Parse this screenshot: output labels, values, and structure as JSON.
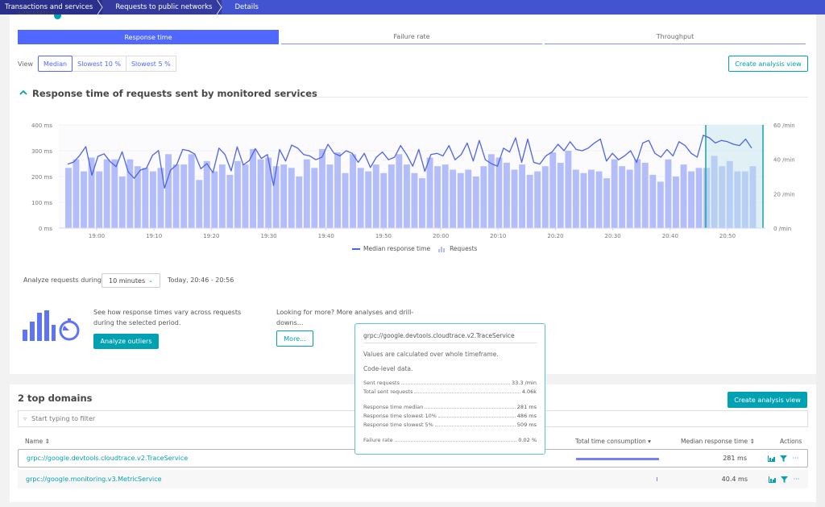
{
  "breadcrumb": [
    {
      "label": "Transactions and services"
    },
    {
      "label": "Requests to public networks"
    },
    {
      "label": "Details"
    }
  ],
  "details": {
    "title": "Details",
    "info_icon": "info-icon"
  },
  "tabs": [
    {
      "label": "Response time",
      "active": true
    },
    {
      "label": "Failure rate",
      "active": false
    },
    {
      "label": "Throughput",
      "active": false
    }
  ],
  "view": {
    "label": "View",
    "options": [
      "Median",
      "Slowest 10 %",
      "Slowest 5 %"
    ],
    "selected": "Median"
  },
  "create_analysis_view_label": "Create analysis view",
  "section": {
    "title": "Response time of requests sent by monitored services",
    "collapse_icon": "chevron-up-icon"
  },
  "chart_data": {
    "type": "bar",
    "title": "Response time of requests sent by monitored services",
    "x_ticks": [
      "19:00",
      "19:10",
      "19:20",
      "19:30",
      "19:40",
      "19:50",
      "20:00",
      "20:10",
      "20:20",
      "20:30",
      "20:40",
      "20:50"
    ],
    "y_left_ticks": [
      "0 ms",
      "100 ms",
      "200 ms",
      "300 ms",
      "400 ms"
    ],
    "y_right_ticks": [
      "0 /min",
      "20 /min",
      "40 /min",
      "60 /min"
    ],
    "y_left_range": [
      0,
      400
    ],
    "y_right_range": [
      0,
      60
    ],
    "selection": {
      "from": "20:46",
      "to": "20:56"
    },
    "series": [
      {
        "name": "Median response time",
        "type": "line",
        "axis": "left",
        "unit": "ms",
        "values": [
          248,
          256,
          282,
          316,
          205,
          278,
          288,
          258,
          238,
          296,
          218,
          193,
          225,
          232,
          282,
          301,
          155,
          225,
          245,
          305,
          300,
          287,
          230,
          250,
          215,
          310,
          285,
          222,
          315,
          245,
          262,
          308,
          270,
          285,
          165,
          305,
          260,
          322,
          310,
          285,
          280,
          265,
          275,
          325,
          290,
          280,
          300,
          290,
          255,
          290,
          235,
          275,
          295,
          265,
          275,
          320,
          285,
          240,
          305,
          220,
          285,
          290,
          280,
          320,
          265,
          285,
          330,
          260,
          340,
          265,
          250,
          240,
          310,
          295,
          350,
          255,
          345,
          255,
          248,
          280,
          295,
          325,
          300,
          335,
          305,
          300,
          310,
          330,
          345,
          260,
          290,
          265,
          280,
          300,
          255,
          330,
          340,
          290,
          275,
          305,
          280,
          335,
          320,
          290,
          275,
          360,
          350,
          330,
          340,
          335,
          325,
          320,
          345,
          310
        ]
      },
      {
        "name": "Requests",
        "type": "bar",
        "axis": "right",
        "unit": "/min",
        "values": [
          35,
          40,
          33,
          41,
          33,
          40,
          40,
          30,
          40,
          36,
          35,
          33,
          35,
          43,
          37,
          37,
          43,
          28,
          39,
          33,
          37,
          31,
          39,
          37,
          46,
          40,
          41,
          36,
          37,
          35,
          30,
          40,
          35,
          46,
          37,
          44,
          32,
          43,
          35,
          33,
          37,
          32,
          37,
          43,
          37,
          32,
          29,
          41,
          36,
          37,
          34,
          32,
          34,
          30,
          36,
          43,
          41,
          38,
          34,
          37,
          31,
          33,
          36,
          44,
          38,
          45,
          34,
          32,
          34,
          33,
          29,
          40,
          36,
          34,
          40,
          38,
          31,
          27,
          40,
          30,
          37,
          33,
          35,
          35,
          42,
          36,
          39,
          33,
          33,
          36
        ]
      }
    ],
    "legend": [
      "Median response time",
      "Requests"
    ],
    "legend_position": "bottom-center"
  },
  "analyze": {
    "label": "Analyze requests during",
    "duration_value": "10 minutes",
    "range_text": "Today, 20:46 - 20:56"
  },
  "outliers": {
    "text": "See how response times vary across requests during the selected period.",
    "button_label": "Analyze outliers"
  },
  "more": {
    "text": "Looking for more? More analyses and drill-downs...",
    "button_label": "More..."
  },
  "tooltip": {
    "title": "grpc://google.devtools.cloudtrace.v2.TraceService",
    "note1": "Values are calculated over whole timeframe.",
    "note2": "Code-level data.",
    "groups": [
      [
        {
          "k": "Sent requests",
          "v": "33.3 /min"
        },
        {
          "k": "Total sent requests",
          "v": "4.06k"
        }
      ],
      [
        {
          "k": "Response time median",
          "v": "281 ms"
        },
        {
          "k": "Response time slowest 10%",
          "v": "486 ms"
        },
        {
          "k": "Response time slowest 5%",
          "v": "509 ms"
        }
      ],
      [
        {
          "k": "Failure rate",
          "v": "0.02 %"
        }
      ]
    ]
  },
  "domains": {
    "title": "2 top domains",
    "filter_placeholder": "Start typing to filter",
    "columns": {
      "name": "Name ⇕",
      "total": "Total time consumption ▾",
      "median": "Median response time ⇕",
      "actions": "Actions"
    },
    "rows": [
      {
        "name": "grpc://google.devtools.cloudtrace.v2.TraceService",
        "consumption_fraction": 1.0,
        "median": "281 ms"
      },
      {
        "name": "grpc://google.monitoring.v3.MetricService",
        "consumption_fraction": 0.01,
        "median": "40.4 ms"
      }
    ]
  }
}
